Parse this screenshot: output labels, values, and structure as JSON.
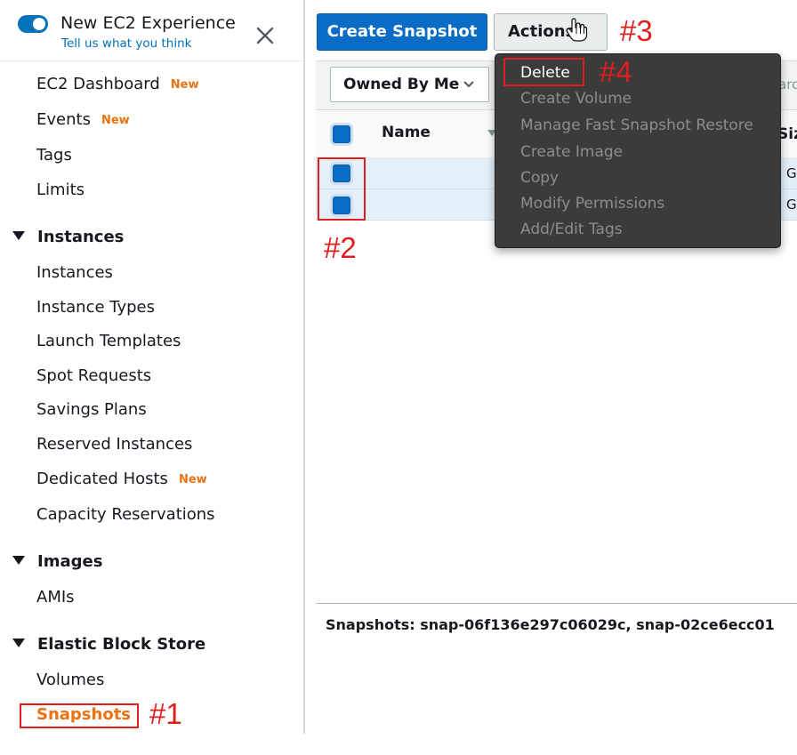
{
  "sidebar": {
    "title": "New EC2 Experience",
    "subtitle_link": "Tell us what you think",
    "close_icon": "close-icon",
    "top_items": [
      {
        "label": "EC2 Dashboard",
        "badge": "New"
      },
      {
        "label": "Events",
        "badge": "New"
      },
      {
        "label": "Tags",
        "badge": ""
      },
      {
        "label": "Limits",
        "badge": ""
      }
    ],
    "sections": {
      "instances": {
        "label": "Instances",
        "items": [
          {
            "label": "Instances",
            "badge": ""
          },
          {
            "label": "Instance Types",
            "badge": ""
          },
          {
            "label": "Launch Templates",
            "badge": ""
          },
          {
            "label": "Spot Requests",
            "badge": ""
          },
          {
            "label": "Savings Plans",
            "badge": ""
          },
          {
            "label": "Reserved Instances",
            "badge": ""
          },
          {
            "label": "Dedicated Hosts",
            "badge": "New"
          },
          {
            "label": "Capacity Reservations",
            "badge": ""
          }
        ]
      },
      "images": {
        "label": "Images",
        "items": [
          {
            "label": "AMIs"
          }
        ]
      },
      "ebs": {
        "label": "Elastic Block Store",
        "items": [
          {
            "label": "Volumes"
          },
          {
            "label": "Snapshots",
            "active": true
          }
        ]
      }
    }
  },
  "toolbar": {
    "create_label": "Create Snapshot",
    "actions_label": "Actions",
    "filter_label": "Owned By Me",
    "search_stub": "arc"
  },
  "table": {
    "columns": [
      "Name",
      "Siz"
    ],
    "rows": [
      {
        "selected": true,
        "size_stub": "G"
      },
      {
        "selected": true,
        "size_stub": "G"
      }
    ]
  },
  "actions_menu": [
    {
      "label": "Delete",
      "enabled": true
    },
    {
      "label": "Create Volume",
      "enabled": false
    },
    {
      "label": "Manage Fast Snapshot Restore",
      "enabled": false
    },
    {
      "label": "Create Image",
      "enabled": false
    },
    {
      "label": "Copy",
      "enabled": false
    },
    {
      "label": "Modify Permissions",
      "enabled": false
    },
    {
      "label": "Add/Edit Tags",
      "enabled": false
    }
  ],
  "details": {
    "text": "Snapshots: snap-06f136e297c06029c, snap-02ce6ecc01"
  },
  "annotations": [
    "#1",
    "#2",
    "#3",
    "#4"
  ],
  "colors": {
    "accent": "#0a6cc5",
    "active_nav": "#ec7211",
    "annotation": "#e01e1e",
    "menu_bg": "#3b3b3b"
  }
}
